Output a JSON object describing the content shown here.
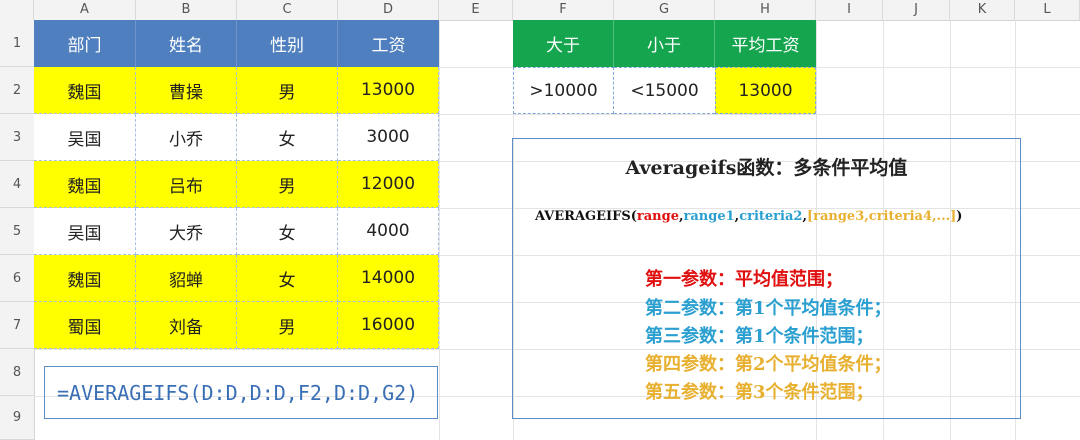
{
  "columns": [
    "A",
    "B",
    "C",
    "D",
    "E",
    "F",
    "G",
    "H",
    "I",
    "J",
    "K",
    "L"
  ],
  "rows": [
    "1",
    "2",
    "3",
    "4",
    "5",
    "6",
    "7",
    "8",
    "9"
  ],
  "table": {
    "headers": [
      "部门",
      "姓名",
      "性别",
      "工资"
    ],
    "rows": [
      [
        "魏国",
        "曹操",
        "男",
        "13000"
      ],
      [
        "吴国",
        "小乔",
        "女",
        "3000"
      ],
      [
        "魏国",
        "吕布",
        "男",
        "12000"
      ],
      [
        "吴国",
        "大乔",
        "女",
        "4000"
      ],
      [
        "魏国",
        "貂蝉",
        "女",
        "14000"
      ],
      [
        "蜀国",
        "刘备",
        "男",
        "16000"
      ]
    ]
  },
  "criteria": {
    "headers": [
      "大于",
      "小于",
      "平均工资"
    ],
    "values": [
      ">10000",
      "<15000",
      "13000"
    ]
  },
  "formula": "=AVERAGEIFS(D:D,D:D,F2,D:D,G2)",
  "explanation": {
    "title": "Averageifs函数：多条件平均值",
    "syntax": {
      "fn": "AVERAGEIFS(",
      "a1": "range",
      "c1": ",",
      "a2": "range1",
      "c2": ",",
      "a3": "criteria2",
      "c3": ",",
      "a4": "[range3,criteria4,...]",
      "close": ")"
    },
    "lines": [
      {
        "text": "第一参数：平均值范围；",
        "color": "#e01010"
      },
      {
        "text": "第二参数：第1个平均值条件；",
        "color": "#2a9fd0"
      },
      {
        "text": "第三参数：第1个条件范围；",
        "color": "#2a9fd0"
      },
      {
        "text": "第四参数：第2个平均值条件；",
        "color": "#e8b030"
      },
      {
        "text": "第五参数：第3个条件范围；",
        "color": "#e8b030"
      }
    ]
  },
  "colors": {
    "header_blue": "#4f7fbe",
    "header_green": "#16a54f",
    "highlight_yellow": "#ffff00",
    "syntax_black": "#111111",
    "syntax_red": "#e01010",
    "syntax_blue": "#2a9fd0",
    "syntax_orange": "#e8b030"
  }
}
